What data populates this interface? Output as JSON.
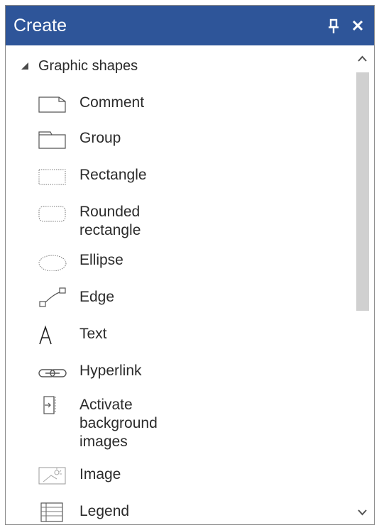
{
  "panel": {
    "title": "Create",
    "pin_icon": "pin-icon",
    "close_icon": "close-icon",
    "colors": {
      "titlebar": "#2e5599",
      "title_text": "#ffffff",
      "scroll_thumb": "#d0d0d0"
    }
  },
  "group": {
    "label": "Graphic shapes",
    "expanded": true,
    "items": [
      {
        "label": "Comment",
        "icon": "comment-icon"
      },
      {
        "label": "Group",
        "icon": "group-icon"
      },
      {
        "label": "Rectangle",
        "icon": "rectangle-icon"
      },
      {
        "label": "Rounded rectangle",
        "icon": "rounded-rectangle-icon"
      },
      {
        "label": "Ellipse",
        "icon": "ellipse-icon"
      },
      {
        "label": "Edge",
        "icon": "edge-icon"
      },
      {
        "label": "Text",
        "icon": "text-icon"
      },
      {
        "label": "Hyperlink",
        "icon": "hyperlink-icon"
      },
      {
        "label": "Activate background images",
        "icon": "activate-background-icon"
      },
      {
        "label": "Image",
        "icon": "image-icon"
      },
      {
        "label": "Legend",
        "icon": "legend-icon"
      }
    ]
  }
}
